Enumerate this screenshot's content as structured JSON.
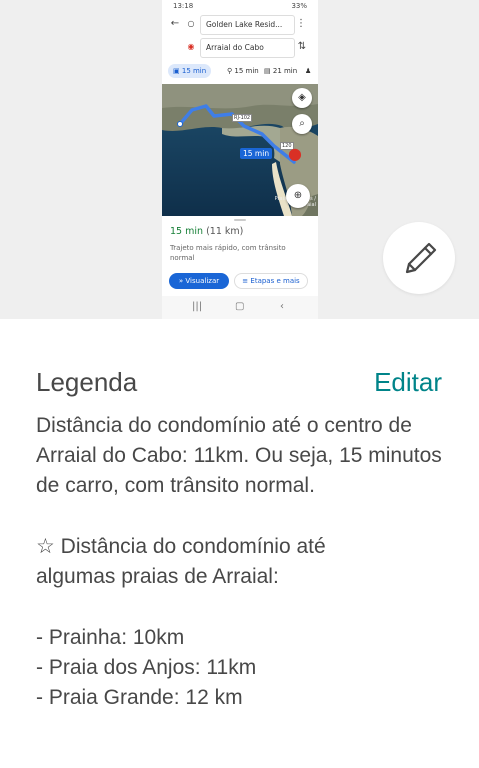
{
  "phone": {
    "status": {
      "time": "13:18",
      "right": "33%"
    },
    "origin": "Golden Lake Resid...",
    "destination": "Arraial do Cabo",
    "modes": [
      {
        "icon": "car-icon",
        "label": "15 min",
        "active": true
      },
      {
        "icon": "motorcycle-icon",
        "label": "15 min",
        "active": false
      },
      {
        "icon": "bus-icon",
        "label": "21 min",
        "active": false
      }
    ],
    "map": {
      "route_time": "15 min",
      "road_label_1": "RJ-102",
      "road_label_2": "120",
      "place_label": "Praia dos Anjos / Arraial"
    },
    "sheet": {
      "time": "15 min",
      "distance": "(11 km)",
      "description": "Trajeto mais rápido, com trânsito normal",
      "visualizar_label": "Visualizar",
      "etapas_label": "Etapas e mais"
    }
  },
  "caption": {
    "title": "Legenda",
    "edit_label": "Editar",
    "paragraph1": "Distância do condomínio até o centro de Arraial do Cabo: 11km. Ou seja, 15 minutos de carro, com trânsito normal.",
    "paragraph2": "☆ Distância do condomínio até algumas praias de Arraial:",
    "items": [
      "- Prainha: 10km",
      "- Praia dos Anjos: 11km",
      "- Praia Grande: 12 km"
    ]
  },
  "colors": {
    "accent": "#008489",
    "text": "#484848",
    "maps_blue": "#1a66d6",
    "maps_green": "#188038"
  }
}
